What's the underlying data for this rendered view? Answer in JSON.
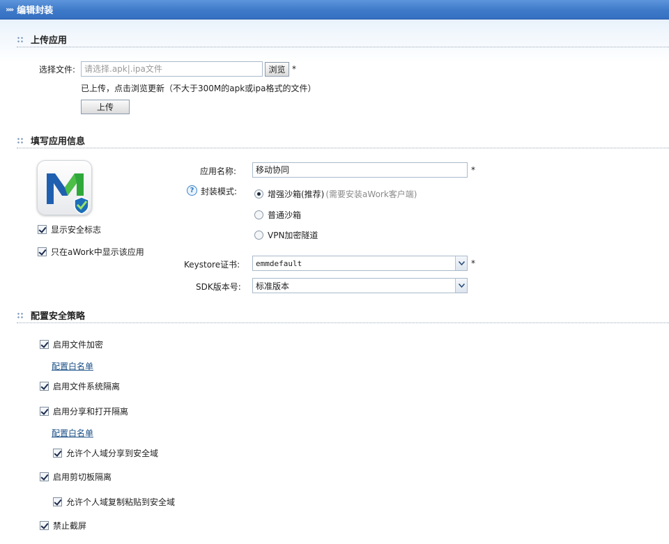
{
  "window": {
    "title": "编辑封装"
  },
  "sections": {
    "upload": "上传应用",
    "info": "填写应用信息",
    "security": "配置安全策略"
  },
  "upload": {
    "file_label": "选择文件:",
    "file_placeholder": "请选择.apk|.ipa文件",
    "browse_label": "浏览",
    "required_mark": "*",
    "status_text": "已上传，点击浏览更新（不大于300M的apk或ipa格式的文件）",
    "upload_label": "上传"
  },
  "app_info": {
    "icon": "app-m-logo-icon",
    "show_security_badge": {
      "label": "显示安全标志",
      "checked": true
    },
    "show_only_in_awork": {
      "label": "只在aWork中显示该应用",
      "checked": true
    },
    "name_label": "应用名称:",
    "name_value": "移动协同",
    "mode_label": "封装模式:",
    "modes": [
      {
        "label": "增强沙箱(推荐)",
        "hint": "(需要安装aWork客户端)",
        "selected": true
      },
      {
        "label": "普通沙箱",
        "hint": "",
        "selected": false
      },
      {
        "label": "VPN加密隧道",
        "hint": "",
        "selected": false
      }
    ],
    "keystore_label": "Keystore证书:",
    "keystore_value": "emmdefault",
    "sdk_label": "SDK版本号:",
    "sdk_value": "标准版本",
    "required_mark": "*"
  },
  "security": {
    "file_encrypt": "启用文件加密",
    "whitelist_1": "配置白名单",
    "fs_isolation": "启用文件系统隔离",
    "share_isolation": "启用分享和打开隔离",
    "whitelist_2": "配置白名单",
    "allow_share": "允许个人域分享到安全域",
    "clipboard_isolation": "启用剪切板隔离",
    "allow_paste": "允许个人域复制粘贴到安全域",
    "no_screenshot": "禁止截屏"
  },
  "colors": {
    "titlebar": "#3e79c9",
    "link": "#1b4f86",
    "icon_blue": "#1f5fb0",
    "icon_green": "#2fa83a"
  }
}
